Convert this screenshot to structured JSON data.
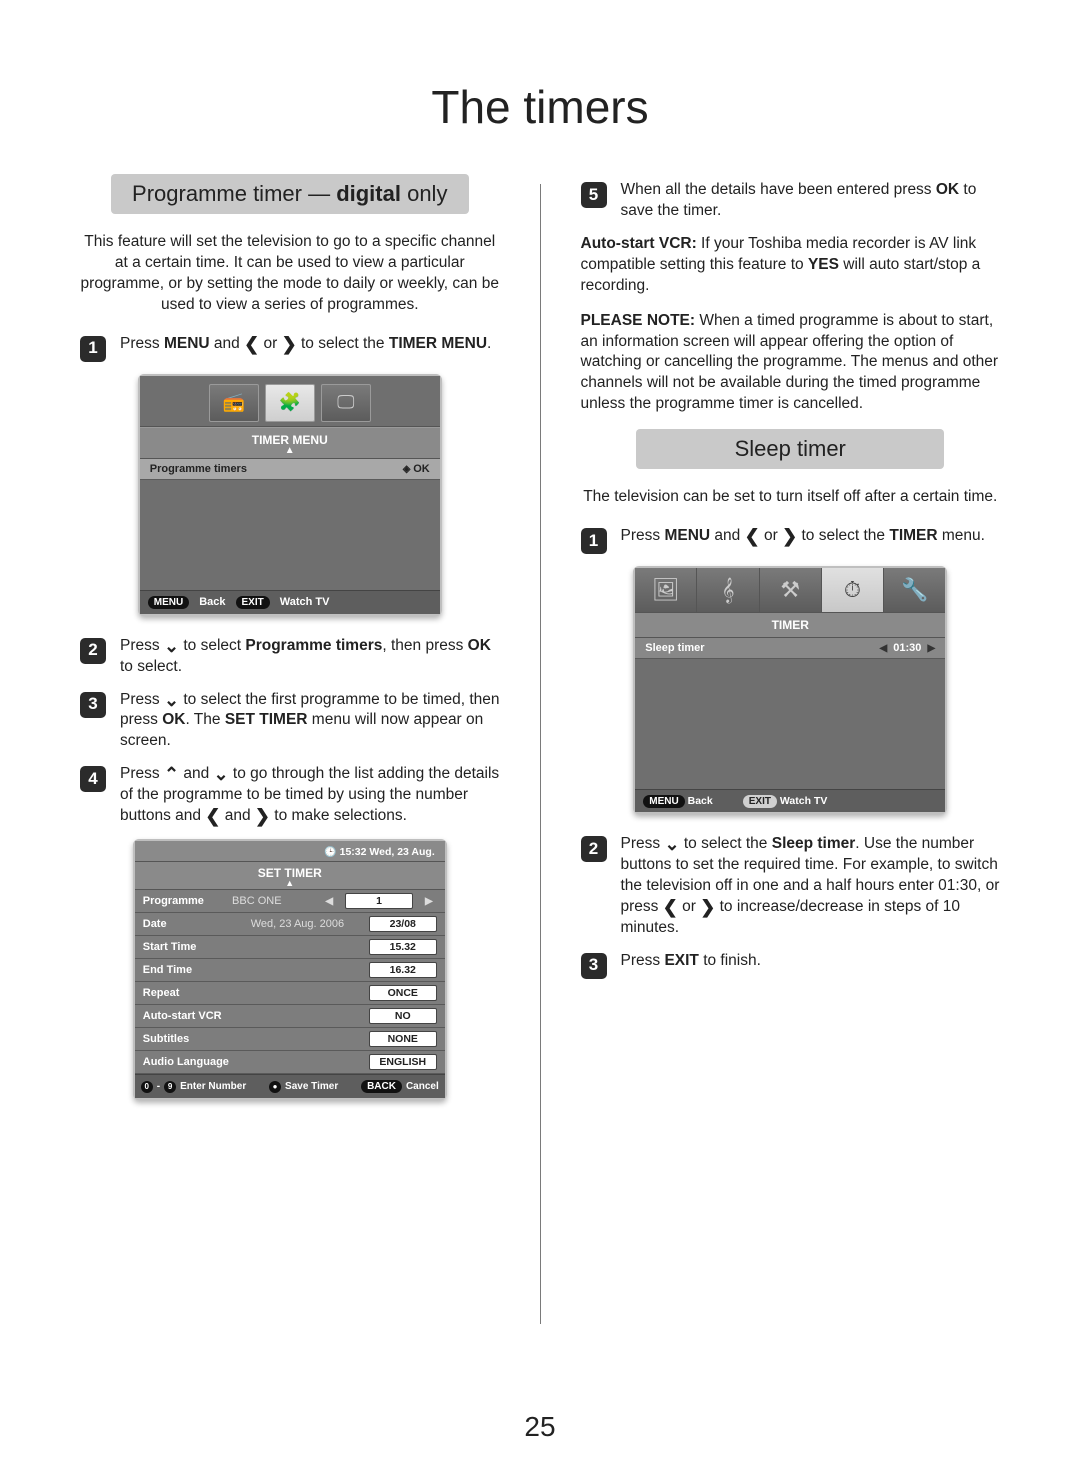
{
  "page_number": "25",
  "title": "The timers",
  "left": {
    "heading_pre": "Programme timer — ",
    "heading_bold": "digital",
    "heading_post": " only",
    "intro": "This feature will set the television to go to a specific channel at a certain time. It can be used to view a particular programme, or by setting the mode to daily or weekly, can be used to view a series of programmes.",
    "step1_a": "Press ",
    "step1_menu": "MENU",
    "step1_b": " and ",
    "step1_c": " or ",
    "step1_d": " to select the ",
    "step1_e": "TIMER MENU",
    "step1_f": ".",
    "osd1": {
      "title": "TIMER MENU",
      "row_label": "Programme timers",
      "row_ok": "OK",
      "foot_menu_pill": "MENU",
      "foot_back": "Back",
      "foot_exit_pill": "EXIT",
      "foot_watch": "Watch TV"
    },
    "step2_a": "Press ",
    "step2_b": " to select ",
    "step2_c": "Programme timers",
    "step2_d": ", then press ",
    "step2_e": "OK",
    "step2_f": " to select.",
    "step3_a": "Press ",
    "step3_b": " to select the first programme to be timed, then press ",
    "step3_c": "OK",
    "step3_d": ". The ",
    "step3_e": "SET TIMER",
    "step3_f": " menu will now appear on screen.",
    "step4_a": "Press ",
    "step4_b": " and ",
    "step4_c": " to go through the list adding the details of the programme to be timed by using the number buttons and ",
    "step4_d": " and ",
    "step4_e": " to make selections.",
    "set": {
      "datetime": "15:32 Wed, 23 Aug.",
      "title": "SET TIMER",
      "rows": [
        {
          "label": "Programme",
          "value": "BBC ONE",
          "field": "1",
          "first": true
        },
        {
          "label": "Date",
          "value": "Wed, 23 Aug. 2006",
          "field": "23/08"
        },
        {
          "label": "Start Time",
          "value": "",
          "field": "15.32"
        },
        {
          "label": "End Time",
          "value": "",
          "field": "16.32"
        },
        {
          "label": "Repeat",
          "value": "",
          "field": "ONCE"
        },
        {
          "label": "Auto-start VCR",
          "value": "",
          "field": "NO"
        },
        {
          "label": "Subtitles",
          "value": "",
          "field": "NONE"
        },
        {
          "label": "Audio Language",
          "value": "",
          "field": "ENGLISH"
        }
      ],
      "foot_enter_a": "0",
      "foot_enter_dash": "-",
      "foot_enter_b": "9",
      "foot_enter": "Enter Number",
      "foot_save": "Save Timer",
      "foot_back_pill": "BACK",
      "foot_cancel": "Cancel"
    }
  },
  "right": {
    "step5_a": "When all the details have been entered press ",
    "step5_b": "OK",
    "step5_c": " to save the timer.",
    "para1_a": "Auto-start VCR:",
    "para1_b": " If your Toshiba media recorder is AV link compatible setting this feature to ",
    "para1_c": "YES",
    "para1_d": " will auto start/stop a recording.",
    "para2_a": "PLEASE NOTE:",
    "para2_b": " When a timed programme is about to start, an information screen will appear offering the option of watching or cancelling the programme. The menus and other channels will not be available during the timed programme unless the programme timer is cancelled.",
    "heading2": "Sleep timer",
    "intro2": "The television can be set to turn itself off after a certain time.",
    "s1_a": "Press ",
    "s1_menu": "MENU",
    "s1_b": " and ",
    "s1_c": " or ",
    "s1_d": " to select the ",
    "s1_e": "TIMER",
    "s1_f": " menu.",
    "sleep_osd": {
      "title": "TIMER",
      "row_label": "Sleep timer",
      "row_value": "01:30",
      "foot_menu_pill": "MENU",
      "foot_back": "Back",
      "foot_exit_pill": "EXIT",
      "foot_watch": "Watch TV"
    },
    "s2_a": "Press ",
    "s2_b": " to select the ",
    "s2_c": "Sleep timer",
    "s2_d": ". Use the number buttons to set the required time. For example, to switch the television off in one and a half hours enter 01:30, or press ",
    "s2_e": " or ",
    "s2_f": " to increase/decrease in steps of 10 minutes.",
    "s3_a": "Press ",
    "s3_b": "EXIT",
    "s3_c": " to finish."
  }
}
